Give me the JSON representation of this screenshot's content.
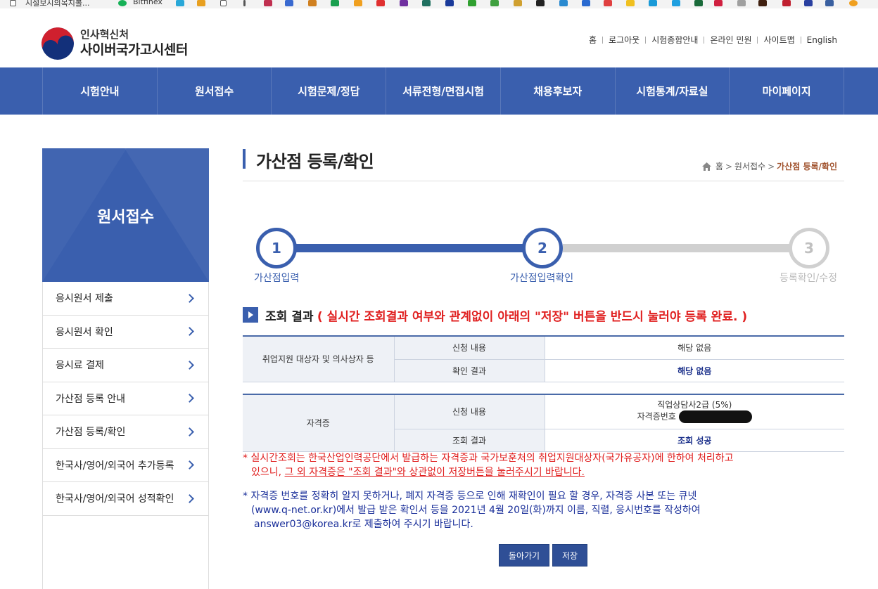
{
  "browser": {
    "bookmarks": [
      {
        "label": "시설보시의목지볼...",
        "icon": "page-icon",
        "color": "#ffffff"
      },
      {
        "label": "Bitfinex",
        "icon": "bitfinex-icon",
        "color": "#16b157"
      }
    ]
  },
  "header": {
    "org_name": "인사혁신처",
    "site_name": "사이버국가고시센터",
    "util_links": [
      "홈",
      "로그아웃",
      "시험종합안내",
      "온라인 민원",
      "사이트맵",
      "English"
    ]
  },
  "gnb": {
    "items": [
      "시험안내",
      "원서접수",
      "시험문제/정답",
      "서류전형/면접시험",
      "채용후보자",
      "시험통계/자료실",
      "마이페이지"
    ]
  },
  "lnb": {
    "title": "원서접수",
    "items": [
      "응시원서 제출",
      "응시원서 확인",
      "응시료 결제",
      "가산점 등록 안내",
      "가산점 등록/확인",
      "한국사/영어/외국어 추가등록",
      "한국사/영어/외국어 성적확인"
    ]
  },
  "page": {
    "title": "가산점 등록/확인",
    "breadcrumb": {
      "home": "홈",
      "parent": "원서접수",
      "current": "가산점 등록/확인"
    }
  },
  "stepper": {
    "current_step": 2,
    "steps": [
      {
        "number": "1",
        "label": "가산점입력"
      },
      {
        "number": "2",
        "label": "가산점입력확인"
      },
      {
        "number": "3",
        "label": "등록확인/수정"
      }
    ]
  },
  "result": {
    "label": "조회 결과",
    "warning": "( 실시간 조회결과 여부와 관계없이 아래의 \"저장\" 버튼을 반드시 눌러야 등록 완료. )"
  },
  "table1": {
    "category": "취업지원 대상자 및 의사상자 등",
    "request_label": "신청 내용",
    "request_value": "해당 없음",
    "check_label": "확인 결과",
    "check_value": "해당 없음"
  },
  "table2": {
    "category": "자격증",
    "request_label": "신청 내용",
    "request_value": "직업상담사2급 (5%)",
    "cert_no_label": "자격증번호",
    "check_label": "조회 결과",
    "check_value": "조회 성공"
  },
  "notes": {
    "red_line1": "* 실시간조회는 한국산업인력공단에서 발급하는 자격증과 국가보훈처의 취업지원대상자(국가유공자)에 한하여 처리하고",
    "red_line2a": "있으니, ",
    "red_line2b": "그 외 자격증은 \"조회 결과\"와 상관없이 저장버튼을 눌러주시기 바랍니다.",
    "blue_line1": "* 자격증 번호를 정확히 알지 못하거나, 폐지 자격증 등으로 인해 재확인이 필요 할 경우, 자격증 사본 또는 큐넷",
    "blue_line2": "(www.q-net.or.kr)에서 발급 받은 확인서 등을 2021년 4월 20일(화)까지 이름, 직렬, 응시번호를 작성하여",
    "blue_line3": "answer03@korea.kr로 제출하여 주시기 바랍니다."
  },
  "buttons": {
    "back": "돌아가기",
    "save": "저장"
  },
  "colors": {
    "primary": "#3a5fae",
    "warning": "#e02020",
    "note_blue": "#1a2f9a",
    "breadcrumb_current": "#a0522d"
  }
}
